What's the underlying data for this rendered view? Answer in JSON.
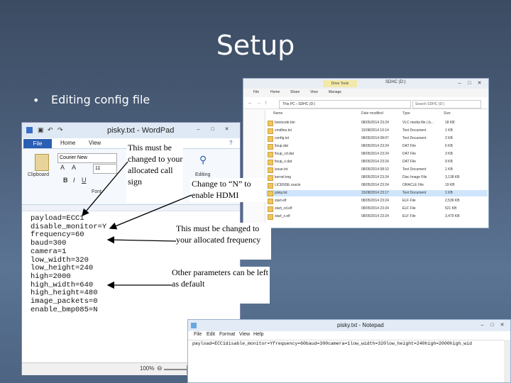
{
  "slide": {
    "title": "Setup",
    "bullet_marker": "•",
    "bullet": "Editing config file"
  },
  "explorer": {
    "tools_tab": "Drive Tools",
    "title": "SDHC (D:)",
    "menu": [
      "File",
      "Home",
      "Share",
      "View",
      "Manage"
    ],
    "address": "This PC › SDHC (D:)",
    "search_placeholder": "Search SDHC (D:)",
    "columns": [
      "Name",
      "Date modified",
      "Type",
      "Size"
    ],
    "files": [
      {
        "name": "bootcode.bin",
        "date": "08/05/2014 23:24",
        "type": "VLC media file (.b...",
        "size": "18 KB"
      },
      {
        "name": "cmdline.txt",
        "date": "15/08/2014 10:14",
        "type": "Text Document",
        "size": "1 KB"
      },
      {
        "name": "config.txt",
        "date": "08/05/2014 08:07",
        "type": "Text Document",
        "size": "2 KB"
      },
      {
        "name": "fixup.dat",
        "date": "08/05/2014 23:24",
        "type": "DAT File",
        "size": "6 KB"
      },
      {
        "name": "fixup_cd.dat",
        "date": "08/05/2014 23:24",
        "type": "DAT File",
        "size": "3 KB"
      },
      {
        "name": "fixup_x.dat",
        "date": "08/05/2014 23:24",
        "type": "DAT File",
        "size": "9 KB"
      },
      {
        "name": "issue.txt",
        "date": "08/05/2014 08:10",
        "type": "Text Document",
        "size": "1 KB"
      },
      {
        "name": "kernel.img",
        "date": "08/05/2014 23:24",
        "type": "Disc Image File",
        "size": "3,138 KB"
      },
      {
        "name": "LICENSE.oracle",
        "date": "08/05/2014 23:24",
        "type": "ORACLE File",
        "size": "19 KB"
      },
      {
        "name": "pisky.txt",
        "date": "15/08/2014 23:17",
        "type": "Text Document",
        "size": "1 KB"
      },
      {
        "name": "start.elf",
        "date": "08/05/2014 23:24",
        "type": "ELF File",
        "size": "2,536 KB"
      },
      {
        "name": "start_cd.elf",
        "date": "08/05/2014 23:24",
        "type": "ELF File",
        "size": "521 KB"
      },
      {
        "name": "start_x.elf",
        "date": "08/05/2014 23:24",
        "type": "ELF File",
        "size": "3,479 KB"
      }
    ],
    "selected_index": 9
  },
  "wordpad": {
    "title": "pisky.txt - WordPad",
    "file_tab": "File",
    "tabs": [
      "Home",
      "View"
    ],
    "font_name": "Courier New",
    "font_size": "11",
    "clipboard_label": "Clipboard",
    "font_label": "Font",
    "editing_label": "Editing",
    "doc_lines": [
      "payload=ECC1",
      "disable_monitor=Y",
      "frequency=60",
      "baud=300",
      "camera=1",
      "low_width=320",
      "low_height=240",
      "high=2000",
      "high_width=640",
      "high_height=480",
      "image_packets=0",
      "enable_bmp085=N"
    ],
    "zoom": "100%"
  },
  "notepad": {
    "title": "pisky.txt - Notepad",
    "menu": [
      "File",
      "Edit",
      "Format",
      "View",
      "Help"
    ],
    "content": "payload=ECC1disable_monitor=Yfrequency=60baud=300camera=1low_width=320low_height=240high=2000high_wid"
  },
  "callouts": {
    "payload": "This must be changed to your allocated call sign",
    "monitor": "Change to “N” to enable HDMI",
    "frequency": "This must be changed to your allocated frequency",
    "other": "Other parameters can be left as default"
  }
}
